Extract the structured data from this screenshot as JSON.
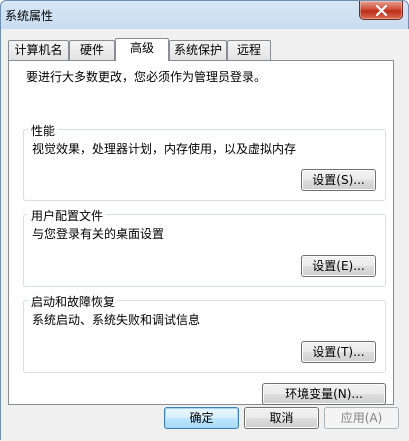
{
  "window": {
    "title": "系统属性"
  },
  "tabs": [
    {
      "label": "计算机名"
    },
    {
      "label": "硬件"
    },
    {
      "label": "高级"
    },
    {
      "label": "系统保护"
    },
    {
      "label": "远程"
    }
  ],
  "active_tab": "高级",
  "notice": "要进行大多数更改，您必须作为管理员登录。",
  "performance": {
    "title": "性能",
    "description": "视觉效果，处理器计划，内存使用，以及虚拟内存",
    "button": "设置(S)..."
  },
  "user_profiles": {
    "title": "用户配置文件",
    "description": "与您登录有关的桌面设置",
    "button": "设置(E)..."
  },
  "startup_recovery": {
    "title": "启动和故障恢复",
    "description": "系统启动、系统失败和调试信息",
    "button": "设置(T)..."
  },
  "env_vars_button": "环境变量(N)...",
  "footer": {
    "ok": "确定",
    "cancel": "取消",
    "apply": "应用(A)"
  },
  "icons": {
    "close": "close-icon"
  }
}
